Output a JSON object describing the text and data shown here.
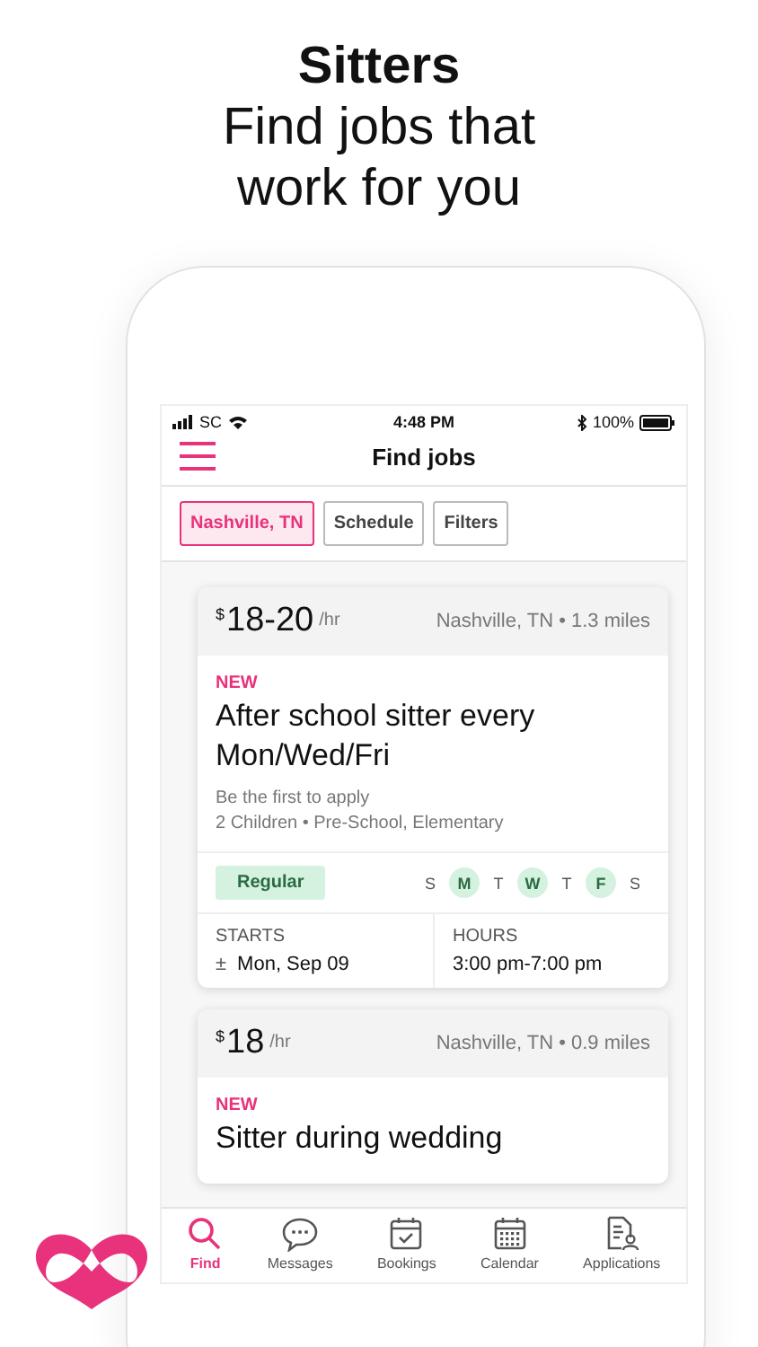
{
  "headline": {
    "title": "Sitters",
    "subtitle": "Find jobs that work for you"
  },
  "status_bar": {
    "carrier": "SC",
    "time": "4:48 PM",
    "battery": "100%"
  },
  "nav": {
    "title": "Find jobs"
  },
  "chips": [
    {
      "label": "Nashville, TN",
      "selected": true
    },
    {
      "label": "Schedule",
      "selected": false
    },
    {
      "label": "Filters",
      "selected": false
    }
  ],
  "jobs": [
    {
      "currency": "$",
      "rate": "18-20",
      "unit": "/hr",
      "location": "Nashville, TN • 1.3 miles",
      "badge": "NEW",
      "title": "After school sitter every Mon/Wed/Fri",
      "note": "Be the first to apply",
      "details": "2 Children • Pre-School, Elementary",
      "schedule_type": "Regular",
      "days": [
        {
          "label": "S",
          "selected": false
        },
        {
          "label": "M",
          "selected": true
        },
        {
          "label": "T",
          "selected": false
        },
        {
          "label": "W",
          "selected": true
        },
        {
          "label": "T",
          "selected": false
        },
        {
          "label": "F",
          "selected": true
        },
        {
          "label": "S",
          "selected": false
        }
      ],
      "starts_label": "STARTS",
      "starts_mark": "±",
      "starts_value": "Mon, Sep 09",
      "hours_label": "HOURS",
      "hours_value": "3:00 pm-7:00 pm"
    },
    {
      "currency": "$",
      "rate": "18",
      "unit": "/hr",
      "location": "Nashville, TN • 0.9 miles",
      "badge": "NEW",
      "title": "Sitter during wedding"
    }
  ],
  "tabs": [
    {
      "label": "Find",
      "kind": "search",
      "selected": true
    },
    {
      "label": "Messages",
      "kind": "chat",
      "selected": false
    },
    {
      "label": "Bookings",
      "kind": "booking",
      "selected": false
    },
    {
      "label": "Calendar",
      "kind": "calendar",
      "selected": false
    },
    {
      "label": "Applications",
      "kind": "applications",
      "selected": false
    }
  ]
}
